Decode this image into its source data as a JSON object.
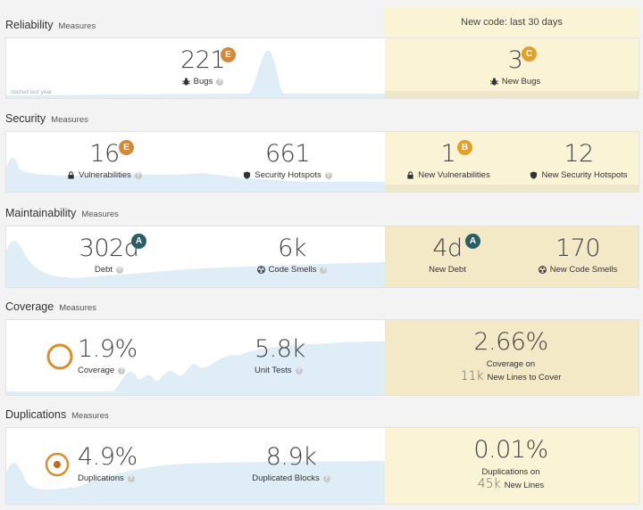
{
  "new_code_header": "New code: last 30 days",
  "colors": {
    "rating_E": "#d4893a",
    "rating_C": "#e0a12c",
    "rating_B": "#e0a12c",
    "rating_A": "#2a5e64",
    "new_code_bg": "#fbf3d5",
    "sparkline": "#dfedf7"
  },
  "reliability": {
    "title": "Reliability",
    "measures": "Measures",
    "started_note": "started last year",
    "bugs": {
      "value": "221",
      "rating": "E",
      "label": "Bugs",
      "icon": "bug-icon"
    },
    "new_bugs": {
      "value": "3",
      "rating": "C",
      "label": "New Bugs",
      "icon": "bug-icon"
    }
  },
  "security": {
    "title": "Security",
    "measures": "Measures",
    "vulnerabilities": {
      "value": "16",
      "rating": "E",
      "label": "Vulnerabilities",
      "icon": "lock-icon"
    },
    "hotspots": {
      "value": "661",
      "label": "Security Hotspots",
      "icon": "shield-icon"
    },
    "new_vulnerabilities": {
      "value": "1",
      "rating": "B",
      "label": "New Vulnerabilities",
      "icon": "lock-icon"
    },
    "new_hotspots": {
      "value": "12",
      "label": "New Security Hotspots",
      "icon": "shield-icon"
    }
  },
  "maintainability": {
    "title": "Maintainability",
    "measures": "Measures",
    "debt": {
      "value": "302d",
      "rating": "A",
      "label": "Debt"
    },
    "code_smells": {
      "value": "6k",
      "label": "Code Smells",
      "icon": "smell-icon"
    },
    "new_debt": {
      "value": "4d",
      "rating": "A",
      "label": "New Debt"
    },
    "new_code_smells": {
      "value": "170",
      "label": "New Code Smells",
      "icon": "smell-icon"
    }
  },
  "coverage": {
    "title": "Coverage",
    "measures": "Measures",
    "coverage": {
      "value": "1.9%",
      "label": "Coverage",
      "fraction": 0.019
    },
    "unit_tests": {
      "value": "5.8k",
      "label": "Unit Tests"
    },
    "new_coverage": {
      "value": "2.66%",
      "label": "Coverage on",
      "lines_value": "11k",
      "lines_label": "New Lines to Cover"
    }
  },
  "duplications": {
    "title": "Duplications",
    "measures": "Measures",
    "duplications": {
      "value": "4.9%",
      "label": "Duplications"
    },
    "duplicated_blocks": {
      "value": "8.9k",
      "label": "Duplicated Blocks"
    },
    "new_duplications": {
      "value": "0.01%",
      "label": "Duplications on",
      "lines_value": "45k",
      "lines_label": "New Lines"
    }
  }
}
